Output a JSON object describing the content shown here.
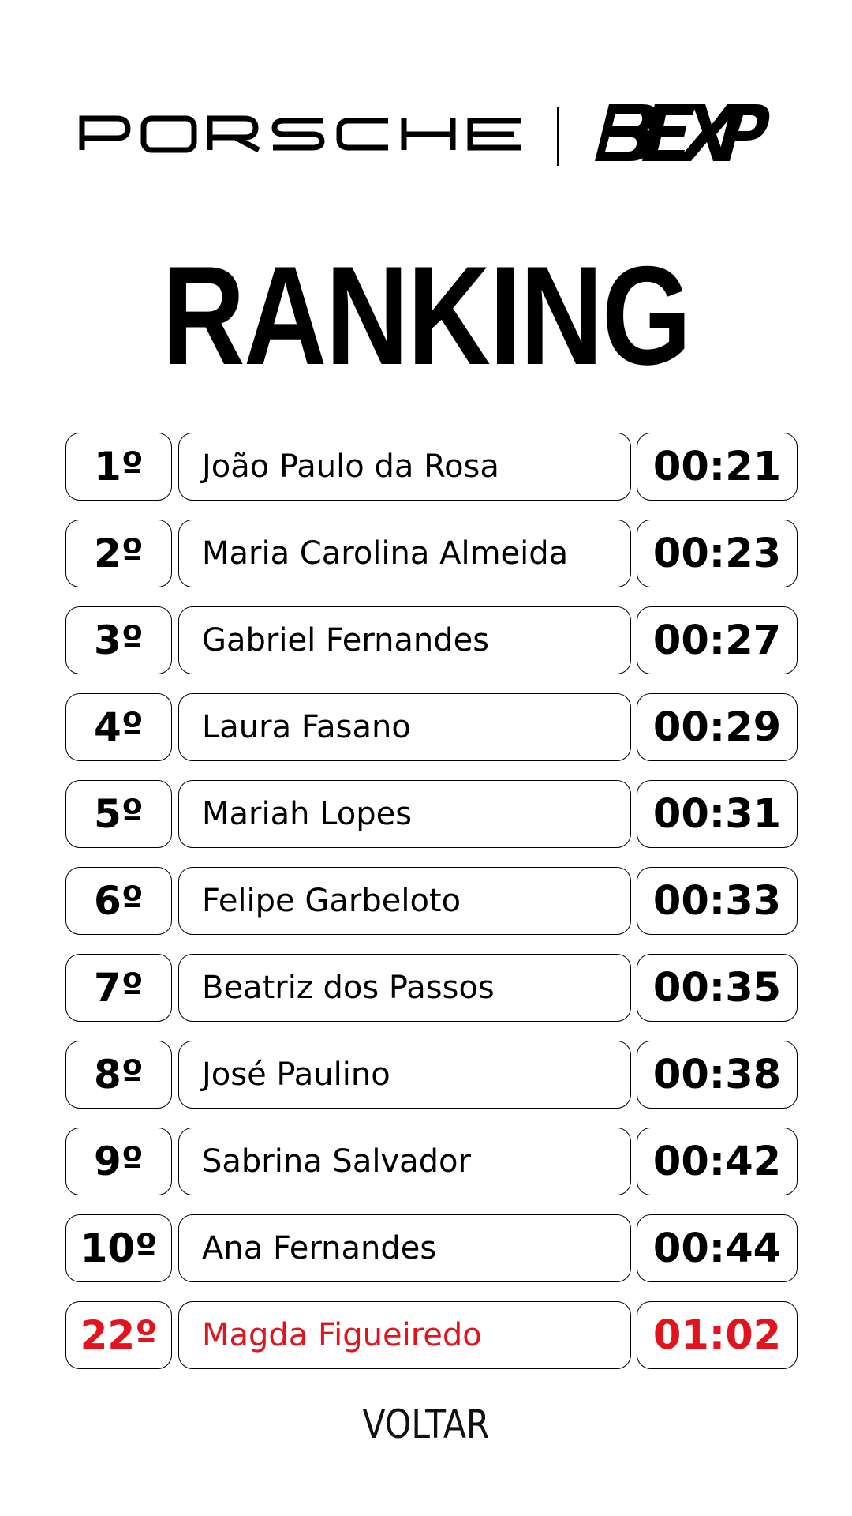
{
  "header": {
    "brand_left": "PORSCHE",
    "brand_right": "BEXP"
  },
  "page_title": "RANKING",
  "colors": {
    "text": "#000000",
    "highlight": "#e2131d",
    "background": "#ffffff"
  },
  "ranking": [
    {
      "position": "1º",
      "name": "João Paulo da Rosa",
      "time": "00:21"
    },
    {
      "position": "2º",
      "name": "Maria Carolina Almeida",
      "time": "00:23"
    },
    {
      "position": "3º",
      "name": "Gabriel Fernandes",
      "time": "00:27"
    },
    {
      "position": "4º",
      "name": "Laura Fasano",
      "time": "00:29"
    },
    {
      "position": "5º",
      "name": "Mariah Lopes",
      "time": "00:31"
    },
    {
      "position": "6º",
      "name": "Felipe Garbeloto",
      "time": "00:33"
    },
    {
      "position": "7º",
      "name": "Beatriz dos Passos",
      "time": "00:35"
    },
    {
      "position": "8º",
      "name": "José Paulino",
      "time": "00:38"
    },
    {
      "position": "9º",
      "name": "Sabrina Salvador",
      "time": "00:42"
    },
    {
      "position": "10º",
      "name": "Ana Fernandes",
      "time": "00:44"
    },
    {
      "position": "22º",
      "name": "Magda Figueiredo",
      "time": "01:02",
      "highlight": true
    }
  ],
  "back_button": {
    "label": "VOLTAR"
  }
}
